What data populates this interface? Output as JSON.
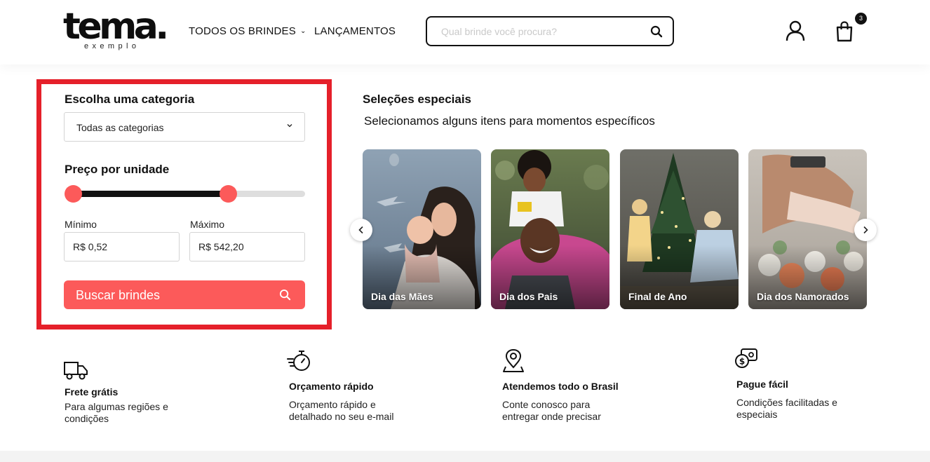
{
  "header": {
    "logo_main": "tema.",
    "logo_sub": "exemplo",
    "nav": {
      "all_gifts": "TODOS OS BRINDES",
      "launches": "LANÇAMENTOS"
    },
    "search_placeholder": "Qual brinde você procura?",
    "cart_count": "3"
  },
  "filter": {
    "category_title": "Escolha uma categoria",
    "category_value": "Todas as categorias",
    "price_title": "Preço por unidade",
    "slider_min_fraction": 0,
    "slider_max_fraction": 0.67,
    "min_label": "Mínimo",
    "max_label": "Máximo",
    "min_value": "R$ 0,52",
    "max_value": "R$ 542,20",
    "button_label": "Buscar brindes"
  },
  "selections": {
    "title": "Seleções especiais",
    "subtitle": "Selecionamos alguns itens para momentos específicos",
    "cards": [
      {
        "label": "Dia das Mães"
      },
      {
        "label": "Dia dos Pais"
      },
      {
        "label": "Final de Ano"
      },
      {
        "label": "Dia dos Namorados"
      }
    ]
  },
  "features": [
    {
      "icon": "truck-icon",
      "title": "Frete grátis",
      "desc": "Para algumas regiões e condições"
    },
    {
      "icon": "stopwatch-icon",
      "title": "Orçamento rápido",
      "desc": "Orçamento rápido e detalhado no seu e-mail"
    },
    {
      "icon": "map-pin-icon",
      "title": "Atendemos todo o Brasil",
      "desc": "Conte conosco para entregar onde precisar"
    },
    {
      "icon": "money-icon",
      "title": "Pague fácil",
      "desc": "Condições facilitadas e especiais"
    }
  ],
  "colors": {
    "accent": "#fc5a5a",
    "highlight": "#e5202a",
    "text": "#111111"
  }
}
